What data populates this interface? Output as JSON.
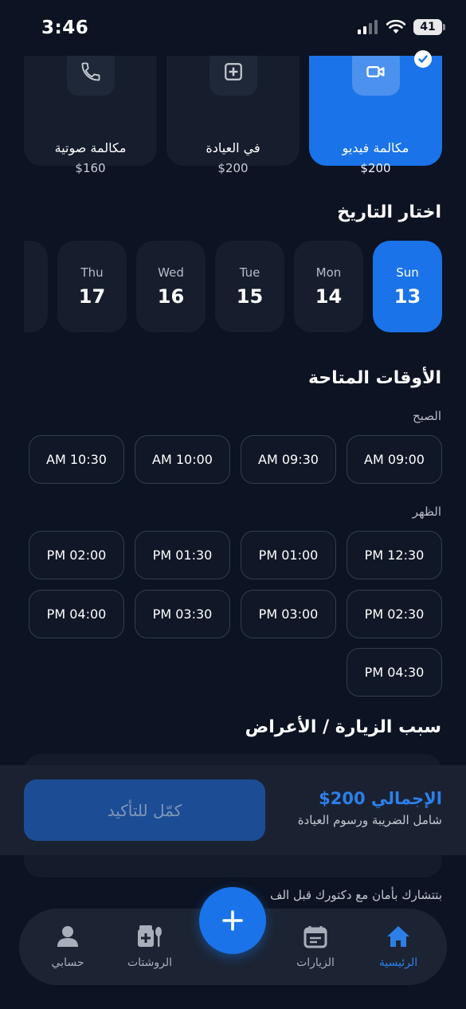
{
  "status": {
    "time": "3:46",
    "battery": "41"
  },
  "consultation": {
    "options": [
      {
        "name": "مكالمة فيديو",
        "price": "$200",
        "icon": "video-icon",
        "selected": true
      },
      {
        "name": "في العيادة",
        "price": "$200",
        "icon": "clinic-plus-icon",
        "selected": false
      },
      {
        "name": "مكالمة صوتية",
        "price": "$160",
        "icon": "phone-icon",
        "selected": false
      }
    ]
  },
  "date_section": {
    "title": "اختار التاريخ",
    "dates": [
      {
        "day": "Sun",
        "num": "13",
        "selected": true
      },
      {
        "day": "Mon",
        "num": "14"
      },
      {
        "day": "Tue",
        "num": "15"
      },
      {
        "day": "Wed",
        "num": "16"
      },
      {
        "day": "Thu",
        "num": "17"
      }
    ]
  },
  "times_section": {
    "title": "الأوقات المتاحة",
    "morning_label": "الصبح",
    "morning": [
      "AM 09:00",
      "AM 09:30",
      "AM 10:00",
      "AM 10:30"
    ],
    "noon_label": "الظهر",
    "noon": [
      "PM 12:30",
      "PM 01:00",
      "PM 01:30",
      "PM 02:00",
      "PM 02:30",
      "PM 03:00",
      "PM 03:30",
      "PM 04:00",
      "PM 04:30"
    ]
  },
  "reason_section": {
    "title": "سبب الزيارة / الأعراض"
  },
  "footer": {
    "total": "الإجمالي 200$",
    "note": "شامل الضريبة ورسوم العيادة",
    "confirm": "كمّل للتأكيد",
    "hint": "بتتشارك بأمان مع دكتورك قبل الف"
  },
  "nav": {
    "items": [
      {
        "label": "الرئيسية",
        "icon": "home-icon",
        "active": true
      },
      {
        "label": "الزيارات",
        "icon": "calendar-icon"
      },
      {
        "label": "الروشتات",
        "icon": "prescription-icon"
      },
      {
        "label": "حسابي",
        "icon": "user-icon"
      }
    ],
    "fab_icon": "plus-icon"
  },
  "colors": {
    "accent": "#1a73e8",
    "background": "#0c1322",
    "card": "#161e2d"
  }
}
